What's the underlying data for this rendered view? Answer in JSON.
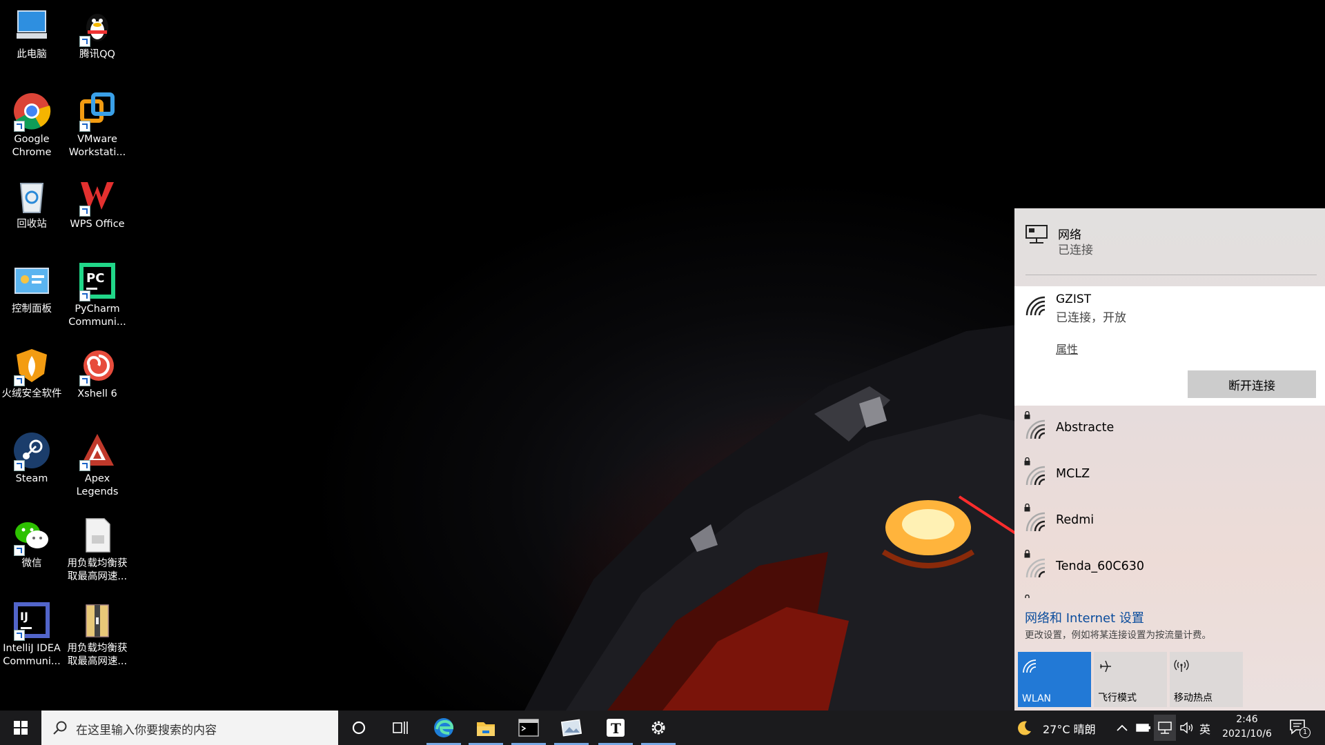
{
  "desktop": {
    "icons": [
      {
        "label": "此电脑"
      },
      {
        "label": "腾讯QQ"
      },
      {
        "label": "Google Chrome"
      },
      {
        "label": "VMware Workstati..."
      },
      {
        "label": "回收站"
      },
      {
        "label": "WPS Office"
      },
      {
        "label": "控制面板"
      },
      {
        "label": "PyCharm Communi..."
      },
      {
        "label": "火绒安全软件"
      },
      {
        "label": "Xshell 6"
      },
      {
        "label": "Steam"
      },
      {
        "label": "Apex Legends"
      },
      {
        "label": "微信"
      },
      {
        "label": "用负载均衡获取最高网速..."
      },
      {
        "label": "IntelliJ IDEA Communi..."
      },
      {
        "label": "用负载均衡获取最高网速..."
      }
    ]
  },
  "network_flyout": {
    "header": {
      "title": "网络",
      "status": "已连接"
    },
    "active": {
      "name": "GZIST",
      "status": "已连接，开放",
      "properties": "属性",
      "disconnect": "断开连接"
    },
    "networks": [
      {
        "name": "Abstracte"
      },
      {
        "name": "MCLZ"
      },
      {
        "name": "Redmi"
      },
      {
        "name": "Tenda_60C630"
      }
    ],
    "settings_link": "网络和 Internet 设置",
    "settings_sub": "更改设置，例如将某连接设置为按流量计费。",
    "quick_actions": [
      {
        "label": "WLAN",
        "active": true
      },
      {
        "label": "飞行模式",
        "active": false
      },
      {
        "label": "移动热点",
        "active": false
      }
    ]
  },
  "taskbar": {
    "search_placeholder": "在这里输入你要搜索的内容",
    "weather": "27°C  晴朗",
    "ime": "英",
    "time": "2:46",
    "date": "2021/10/6",
    "notifications": "1"
  },
  "colors": {
    "accent": "#2279d6",
    "link": "#0a4c9c",
    "annotation_arrow": "#ff2d2d"
  }
}
